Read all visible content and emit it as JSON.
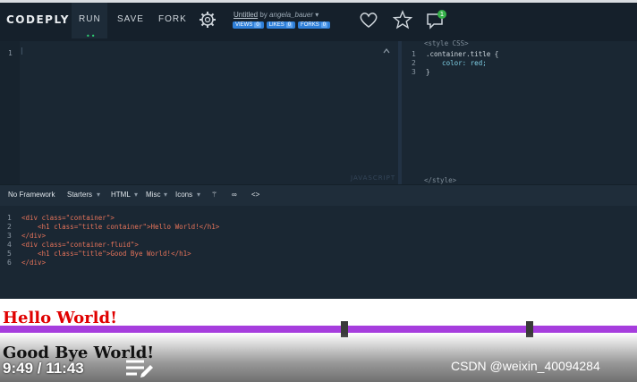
{
  "app": {
    "logo": "CODEPLY"
  },
  "nav": {
    "run": "RUN",
    "save": "SAVE",
    "fork": "FORK"
  },
  "project": {
    "name": "Untitled",
    "by": "by",
    "author": "angela_bauer"
  },
  "badges": [
    {
      "label": "VIEWS",
      "count": "0"
    },
    {
      "label": "LIKES",
      "count": "0"
    },
    {
      "label": "FORKS",
      "count": "0"
    }
  ],
  "notifications": {
    "count": "1"
  },
  "js_editor": {
    "line": "1",
    "label": "JAVASCRIPT"
  },
  "css_editor": {
    "header": "<style CSS>",
    "footer": "</style>",
    "lines": [
      {
        "n": "1",
        "text": ".container.title {"
      },
      {
        "n": "2",
        "text": "    color: red;"
      },
      {
        "n": "3",
        "text": "}"
      }
    ]
  },
  "toolbar": {
    "framework": "No Framework",
    "starters": "Starters",
    "html": "HTML",
    "misc": "Misc",
    "icons": "Icons",
    "infinity": "∞",
    "code": "<>"
  },
  "html_editor": {
    "lines": [
      {
        "n": "1",
        "text": "<div class=\"container\">"
      },
      {
        "n": "2",
        "text": "    <h1 class=\"title container\">Hello World!</h1>"
      },
      {
        "n": "3",
        "text": "</div>"
      },
      {
        "n": "4",
        "text": "<div class=\"container-fluid\">"
      },
      {
        "n": "5",
        "text": "    <h1 class=\"title\">Good Bye World!</h1>"
      },
      {
        "n": "6",
        "text": "</div>"
      }
    ]
  },
  "preview": {
    "heading1": "Hello World!",
    "heading2": "Good Bye World!"
  },
  "video": {
    "time": "9:49 / 11:43",
    "progress": 0.842
  },
  "watermark": "CSDN @weixin_40094284",
  "colors": {
    "accent": "#a63ddd",
    "badge": "#2f7fd8",
    "preview_red": "#e00000"
  }
}
